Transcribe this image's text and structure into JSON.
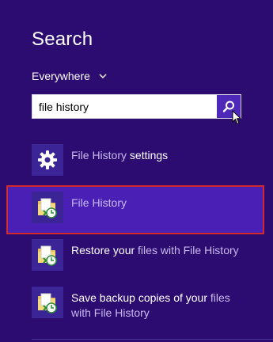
{
  "search": {
    "title": "Search",
    "scope_label": "Everywhere",
    "query": "file history"
  },
  "results": [
    {
      "pre": "",
      "match": "File History",
      "post": " settings",
      "line2": "",
      "icon": "gear-icon"
    },
    {
      "pre": "",
      "match": "File History",
      "post": "",
      "line2": "",
      "icon": "file-history-folder-icon"
    },
    {
      "pre": "Restore your ",
      "match": "files",
      "post": " with File History",
      "line2": "",
      "icon": "file-history-folder-icon"
    },
    {
      "pre": "Save backup copies of your ",
      "match": "files",
      "post": "",
      "line2": "with File History",
      "icon": "file-history-folder-icon"
    }
  ],
  "colors": {
    "background": "#2d0c72",
    "search_button": "#4e28b8",
    "selection_border": "#d22a2a"
  }
}
